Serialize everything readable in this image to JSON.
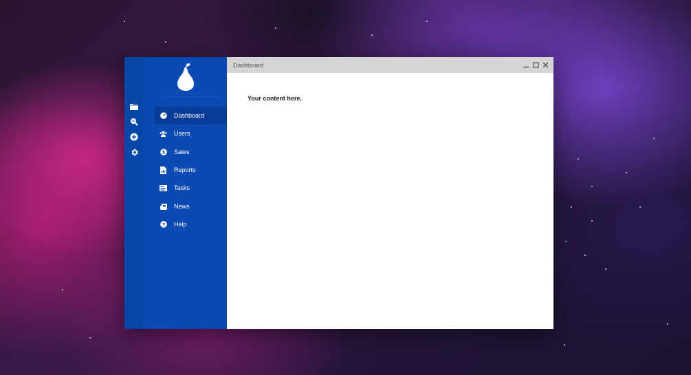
{
  "window": {
    "title": "Dashboard",
    "controls": [
      "minimize-icon",
      "maximize-icon",
      "close-icon"
    ]
  },
  "iconbar": {
    "items": [
      {
        "icon": "folder-icon"
      },
      {
        "icon": "zoom-icon"
      },
      {
        "icon": "add-circle-icon"
      },
      {
        "icon": "gear-icon"
      }
    ]
  },
  "sidebar": {
    "logo_icon": "pear-icon",
    "items": [
      {
        "label": "Dashboard",
        "icon": "speedometer-icon",
        "active": true
      },
      {
        "label": "Users",
        "icon": "users-icon",
        "active": false
      },
      {
        "label": "Sales",
        "icon": "dollar-icon",
        "active": false
      },
      {
        "label": "Reports",
        "icon": "report-icon",
        "active": false
      },
      {
        "label": "Tasks",
        "icon": "tasks-icon",
        "active": false
      },
      {
        "label": "News",
        "icon": "news-icon",
        "active": false
      },
      {
        "label": "Help",
        "icon": "help-icon",
        "active": false
      }
    ]
  },
  "content": {
    "text": "Your content here."
  },
  "colors": {
    "iconbar_bg": "#0747a6",
    "sidebar_bg": "#0b49b3",
    "active_item_bg": "#073c99",
    "titlebar_bg": "#d5d5d5"
  }
}
